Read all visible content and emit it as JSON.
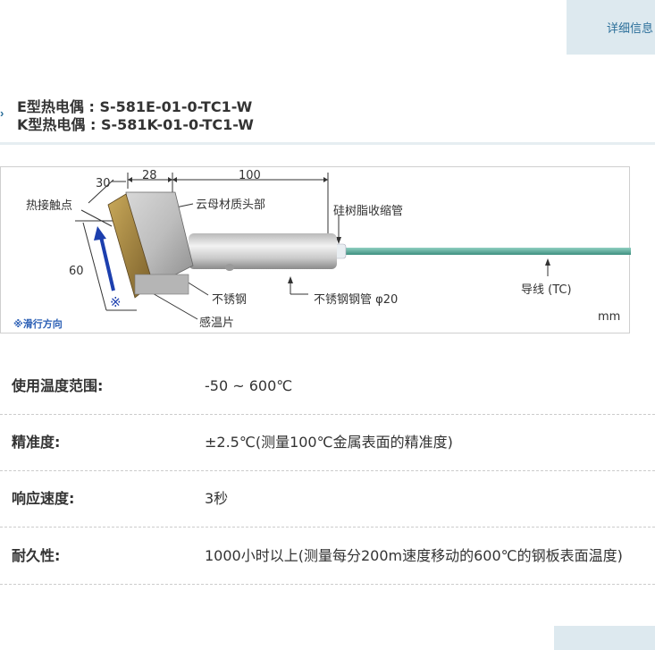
{
  "detail_tab": {
    "label": "详细信息"
  },
  "product": {
    "lines": [
      "E型热电偶 : S-581E-01-0-TC1-W",
      "K型热电偶 : S-581K-01-0-TC1-W"
    ]
  },
  "diagram": {
    "dim_30": "30",
    "dim_28": "28",
    "dim_100": "100",
    "dim_60": "60",
    "label_contact": "热接触点",
    "label_mica_head": "云母材质头部",
    "label_silicone_tube": "硅树脂收缩管",
    "label_stainless": "不锈钢",
    "label_stainless_pipe": "不锈钢钢管 φ20",
    "label_lead": "导线 (TC)",
    "label_sensor_plate": "感温片",
    "slide_mark": "※",
    "slide_note": "※滑行方向",
    "unit": "mm"
  },
  "specs": [
    {
      "label": "使用温度范围:",
      "value": "-50 ~ 600℃"
    },
    {
      "label": "精准度:",
      "value": "±2.5℃(测量100℃金属表面的精准度)"
    },
    {
      "label": "响应速度:",
      "value": "3秒"
    },
    {
      "label": "耐久性:",
      "value": "1000小时以上(测量每分200m速度移动的600℃的钢板表面温度)"
    }
  ]
}
